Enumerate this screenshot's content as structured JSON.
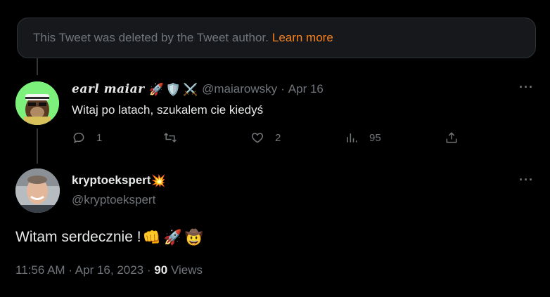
{
  "deleted_notice": {
    "text": "This Tweet was deleted by the Tweet author.",
    "link": "Learn more"
  },
  "reply_tweet": {
    "display_name": "earl maiar",
    "name_emojis": [
      "🚀",
      "🛡️",
      "⚔️"
    ],
    "handle": "@maiarowsky",
    "separator": "·",
    "date": "Apr 16",
    "text": "Witaj po latach, szukalem cie kiedyś",
    "actions": {
      "reply_count": "1",
      "retweet_count": "",
      "like_count": "2",
      "views_count": "95"
    }
  },
  "main_tweet": {
    "display_name": "kryptoekspert",
    "name_emoji": "💥",
    "handle": "@kryptoekspert",
    "text": "Witam serdecznie !",
    "text_emojis": [
      "👊",
      "🚀",
      "🤠"
    ],
    "time": "11:56 AM",
    "dot1": "·",
    "date": "Apr 16, 2023",
    "dot2": "·",
    "views_count": "90",
    "views_label": "Views"
  },
  "more_icon": "···",
  "colors": {
    "background": "#000000",
    "text": "#e7e9ea",
    "muted": "#71767b",
    "link": "#f6821f"
  }
}
